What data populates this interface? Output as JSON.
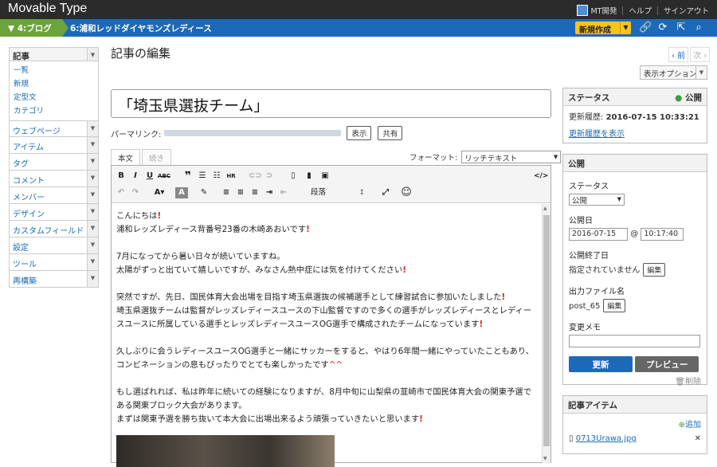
{
  "topbar": {
    "logo": "Movable Type",
    "links": [
      "MT開発",
      "ヘルプ",
      "サインアウト"
    ]
  },
  "nav": {
    "crumb1": "4:ブログ",
    "crumb2": "6:浦和レッドダイヤモンズレディース",
    "new_label": "新規作成"
  },
  "sidebar": {
    "head": "記事",
    "sub": [
      "一覧",
      "新規",
      "定型文",
      "カテゴリ"
    ],
    "items": [
      "ウェブページ",
      "アイテム",
      "タグ",
      "コメント",
      "メンバー",
      "デザイン",
      "カスタムフィールド",
      "設定",
      "ツール",
      "再構築"
    ]
  },
  "page": {
    "title": "記事の編集",
    "prev": "‹ 前",
    "next": "次 ›",
    "display_option": "表示オプション"
  },
  "entry": {
    "title": "「埼玉県選抜チーム」",
    "permalink_label": "パーマリンク:",
    "view_btn": "表示",
    "share_btn": "共有",
    "tabs": [
      "本文",
      "続き"
    ],
    "format_label": "フォーマット:",
    "format_value": "リッチテキスト",
    "para_select": "段落"
  },
  "body": [
    "こんにちは",
    "浦和レッズレディース背番号23番の木崎あおいです",
    "",
    "7月になってから暑い日々が続いていますね。",
    "太陽がずっと出ていて嬉しいですが、みなさん熱中症には気を付けてください",
    "",
    "突然ですが、先日、国民体育大会出場を目指す埼玉県選抜の候補選手として練習試合に参加いたしました",
    "埼玉県選抜チームは監督がレッズレディースユースの下山監督ですので多くの選手がレッズレディースとレディースユースに所属している選手とレッズレディースユースOG選手で構成されたチームになっています",
    "",
    "久しぶりに会うレディースユースOG選手と一緒にサッカーをすると、やはり6年間一緒にやっていたこともあり、コンビネーションの息もぴったりでとても楽しかったです",
    "",
    "もし選ばれれば、私は昨年に続いての経験になりますが、8月中旬に山梨県の韮崎市で国民体育大会の関東予選である関東ブロック大会があります。",
    "まずは関東予選を勝ち抜いて本大会に出場出来るよう頑張っていきたいと思います"
  ],
  "emoji_face": "^^",
  "status": {
    "head": "ステータス",
    "state": "公開",
    "updated_label": "更新履歴:",
    "updated_value": "2016-07-15 10:33:21",
    "history_link": "更新履歴を表示"
  },
  "publish": {
    "head": "公開",
    "status_label": "ステータス",
    "status_value": "公開",
    "date_label": "公開日",
    "date": "2016-07-15",
    "at": "@",
    "time": "10:17:40",
    "end_label": "公開終了日",
    "end_value": "指定されていません",
    "edit": "編集",
    "output_label": "出力ファイル名",
    "output_value": "post_65",
    "memo_label": "変更メモ",
    "update_btn": "更新",
    "preview_btn": "プレビュー",
    "delete": "削除"
  },
  "assets": {
    "head": "記事アイテム",
    "add": "追加",
    "file": "0713Urawa.jpg"
  }
}
